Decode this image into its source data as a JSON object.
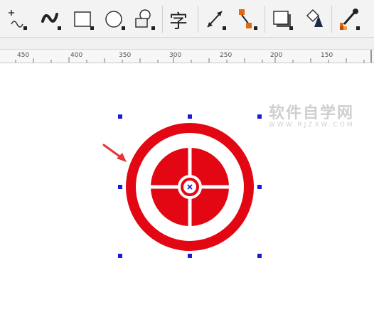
{
  "toolbar": {
    "tools": [
      {
        "name": "interactive-connector-icon"
      },
      {
        "name": "artistic-media-icon"
      },
      {
        "name": "rectangle-icon"
      },
      {
        "name": "ellipse-icon"
      },
      {
        "name": "basic-shapes-icon"
      },
      {
        "name": "text-tool-icon",
        "glyph": "字"
      },
      {
        "name": "dimension-icon"
      },
      {
        "name": "connector-icon"
      },
      {
        "name": "drop-shadow-icon"
      },
      {
        "name": "fill-icon"
      },
      {
        "name": "eyedropper-icon"
      }
    ]
  },
  "ruler": {
    "labels": [
      "450",
      "400",
      "350",
      "300",
      "250",
      "200",
      "150"
    ]
  },
  "watermark": {
    "title": "软件自学网",
    "url": "WWW.RJZXW.COM"
  },
  "colors": {
    "target_red": "#e30613",
    "selection_handle": "#1a1adc",
    "arrow": "#e8333a"
  }
}
